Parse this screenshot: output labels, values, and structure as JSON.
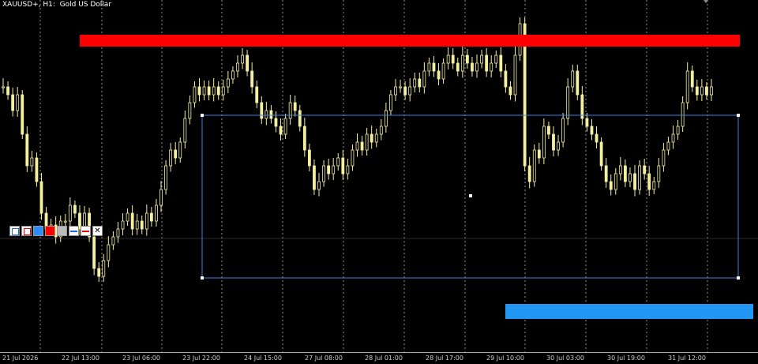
{
  "window": {
    "title": "XAUUSD+, H1:  Gold US Dollar"
  },
  "time_axis": {
    "labels": [
      "21 Jul 2026",
      "22 Jul 13:00",
      "23 Jul 06:00",
      "23 Jul 22:00",
      "24 Jul 15:00",
      "27 Jul 08:00",
      "28 Jul 01:00",
      "28 Jul 17:00",
      "29 Jul 10:00",
      "30 Jul 03:00",
      "30 Jul 19:00",
      "31 Jul 12:00"
    ]
  },
  "toolbar": {
    "items": [
      {
        "name": "hollow-rect-blue-icon"
      },
      {
        "name": "hollow-rect-red-icon"
      },
      {
        "name": "filled-rect-blue-icon"
      },
      {
        "name": "filled-rect-red-icon"
      },
      {
        "name": "filled-rect-gray-icon"
      },
      {
        "name": "line-blue-icon"
      },
      {
        "name": "line-red-icon"
      },
      {
        "name": "close-icon",
        "glyph": "✕"
      }
    ]
  },
  "colors": {
    "background": "#000000",
    "candle": "#f5f0a0",
    "grid": "#d0d0d0",
    "resistance_zone": "#ff0000",
    "support_zone": "#2196f3",
    "range_box": "#3c82e6",
    "crosshair": "#555555"
  },
  "chart_data": {
    "type": "candlestick",
    "grid": true,
    "series": [
      {
        "values": [
          300,
          290,
          270,
          290,
          240,
          200,
          210,
          180,
          140,
          120,
          125,
          110,
          130,
          130,
          150,
          140,
          120,
          140,
          110,
          70,
          60,
          80,
          100,
          110,
          120,
          130,
          140,
          120,
          130,
          120,
          140,
          130,
          150,
          170,
          200,
          220,
          210,
          230,
          260,
          280,
          300,
          290,
          300,
          290,
          300,
          290,
          300,
          310,
          320,
          330,
          340,
          320,
          300,
          280,
          260,
          270,
          260,
          250,
          240,
          260,
          280,
          270,
          250,
          220,
          200,
          170,
          180,
          200,
          190,
          200,
          210,
          190,
          200,
          220,
          230,
          220,
          240,
          230,
          240,
          250,
          270,
          290,
          300,
          300,
          290,
          300,
          310,
          300,
          320,
          330,
          320,
          310,
          330,
          340,
          330,
          320,
          340,
          330,
          320,
          330,
          340,
          320,
          330,
          340,
          320,
          300,
          290,
          340,
          380,
          200,
          180,
          220,
          210,
          250,
          240,
          220,
          230,
          260,
          300,
          320,
          290,
          260,
          250,
          240,
          230,
          200,
          180,
          170,
          190,
          200,
          180,
          190,
          170,
          200,
          190,
          170,
          180,
          200,
          220,
          230,
          240,
          250,
          280,
          320,
          300,
          290,
          300,
          290,
          300
        ]
      }
    ]
  }
}
